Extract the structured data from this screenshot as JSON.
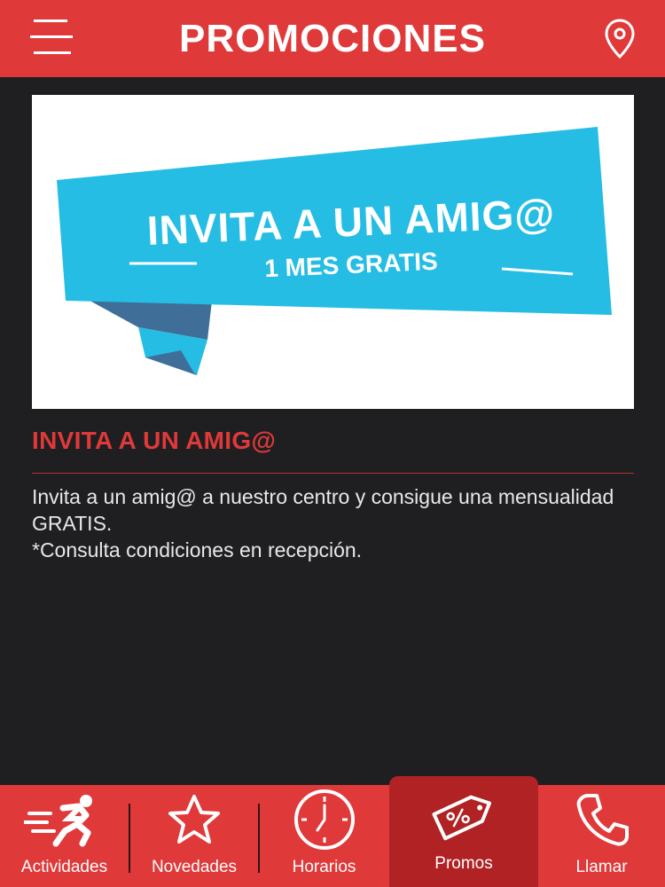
{
  "header": {
    "title": "PROMOCIONES",
    "menu_icon": "hamburger-menu-icon",
    "location_icon": "location-pin-icon"
  },
  "banner": {
    "title": "INVITA A UN AMIG@",
    "subtitle": "1 MES GRATIS",
    "ribbon_color": "#25bde4",
    "ribbon_shadow_color": "#3f6e98"
  },
  "promo": {
    "title": "INVITA A UN AMIG@",
    "body_line1": "Invita  a un amig@ a nuestro centro y consigue una mensualidad GRATIS.",
    "body_line2": "*Consulta condiciones en recepción."
  },
  "nav": {
    "items": [
      {
        "label": "Actividades",
        "icon": "running-person-icon"
      },
      {
        "label": "Novedades",
        "icon": "star-icon"
      },
      {
        "label": "Horarios",
        "icon": "clock-icon"
      },
      {
        "label": "Promos",
        "icon": "percent-tag-icon",
        "active": true
      },
      {
        "label": "Llamar",
        "icon": "phone-icon"
      }
    ]
  },
  "colors": {
    "accent": "#e0393a",
    "background": "#1f1f21",
    "active_tab": "#b02224"
  }
}
